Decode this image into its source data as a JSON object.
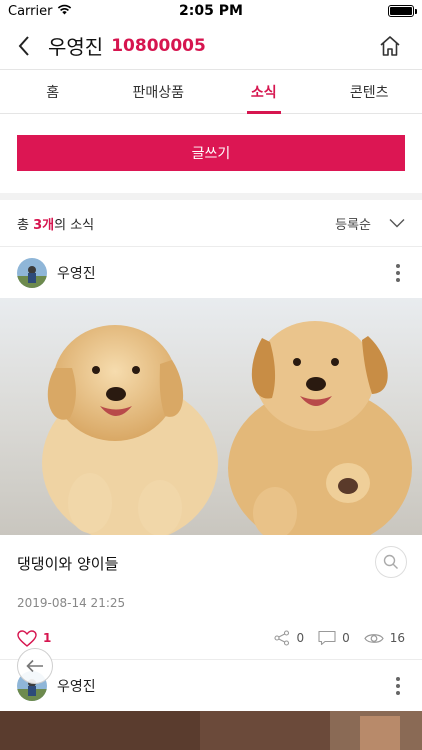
{
  "status": {
    "carrier": "Carrier",
    "time": "2:05 PM"
  },
  "nav": {
    "title": "우영진",
    "code": "10800005"
  },
  "tabs": [
    {
      "label": "홈"
    },
    {
      "label": "판매상품"
    },
    {
      "label": "소식"
    },
    {
      "label": "콘텐츠"
    }
  ],
  "write_button": "글쓰기",
  "list": {
    "prefix": "총 ",
    "count": "3개",
    "suffix": "의 소식",
    "sort": "등록순"
  },
  "posts": [
    {
      "author": "우영진",
      "title": "댕댕이와 양이들",
      "date": "2019-08-14 21:25",
      "likes": "1",
      "shares": "0",
      "comments": "0",
      "views": "16"
    },
    {
      "author": "우영진"
    }
  ],
  "colors": {
    "accent": "#d6154f",
    "button": "#dc1653"
  }
}
